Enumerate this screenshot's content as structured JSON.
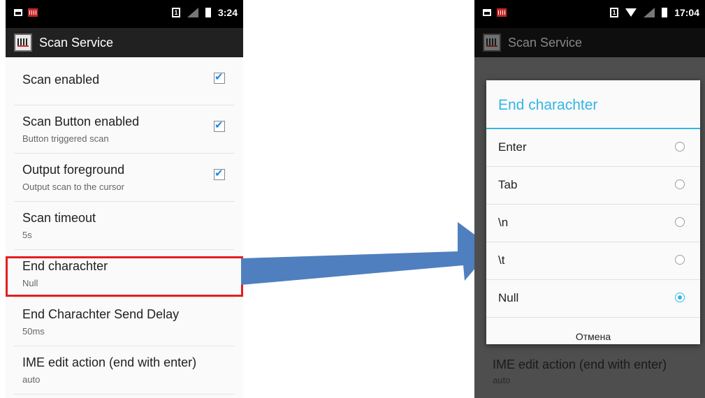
{
  "left_screen": {
    "status_time": "3:24",
    "sim_label": "1",
    "app_title": "Scan Service",
    "settings": [
      {
        "title": "Scan enabled",
        "subtitle": "",
        "checked": true
      },
      {
        "title": "Scan Button enabled",
        "subtitle": "Button triggered scan",
        "checked": true
      },
      {
        "title": "Output foreground",
        "subtitle": "Output scan to the cursor",
        "checked": true
      },
      {
        "title": "Scan timeout",
        "subtitle": "5s"
      },
      {
        "title": "End charachter",
        "subtitle": "Null"
      },
      {
        "title": "End Charachter Send Delay",
        "subtitle": "50ms"
      },
      {
        "title": "IME edit action (end with enter)",
        "subtitle": "auto"
      }
    ]
  },
  "right_screen": {
    "status_time": "17:04",
    "sim_label": "1",
    "app_title": "Scan Service",
    "dialog": {
      "title": "End charachter",
      "options": [
        {
          "label": "Enter",
          "selected": false
        },
        {
          "label": "Tab",
          "selected": false
        },
        {
          "label": "\\n",
          "selected": false
        },
        {
          "label": "\\t",
          "selected": false
        },
        {
          "label": "Null",
          "selected": true
        }
      ],
      "cancel_label": "Отмена"
    },
    "background_item": {
      "title": "IME edit action (end with enter)",
      "subtitle": "auto"
    }
  },
  "colors": {
    "accent": "#33b5e5",
    "highlight": "#e41e1e",
    "arrow": "#4f7fbe",
    "checkbox": "#1e88e5"
  }
}
